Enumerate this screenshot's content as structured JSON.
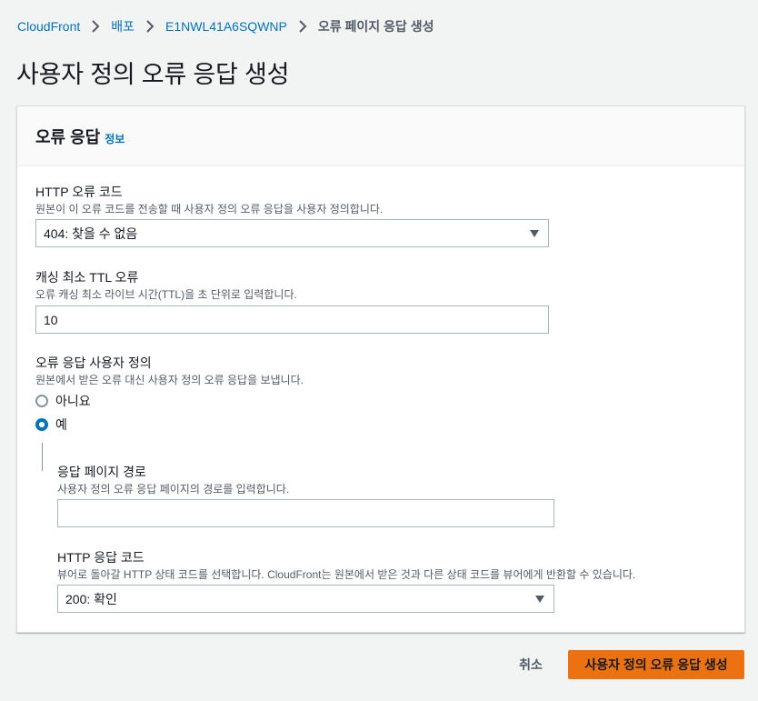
{
  "breadcrumb": {
    "items": [
      "CloudFront",
      "배포",
      "E1NWL41A6SQWNP"
    ],
    "current": "오류 페이지 응답 생성"
  },
  "page_title": "사용자 정의 오류 응답 생성",
  "panel": {
    "title": "오류 응답",
    "info_link": "정보"
  },
  "http_error_code": {
    "label": "HTTP 오류 코드",
    "description": "원본이 이 오류 코드를 전송할 때 사용자 정의 오류 응답을 사용자 정의합니다.",
    "selected": "404: 찾을 수 없음"
  },
  "min_ttl": {
    "label": "캐싱 최소 TTL 오류",
    "description": "오류 캐싱 최소 라이브 시간(TTL)을 초 단위로 입력합니다.",
    "value": "10"
  },
  "customize_response": {
    "label": "오류 응답 사용자 정의",
    "description": "원본에서 받은 오류 대신 사용자 정의 오류 응답을 보냅니다.",
    "options": [
      "아니요",
      "예"
    ],
    "selected": "예"
  },
  "response_page_path": {
    "label": "응답 페이지 경로",
    "description": "사용자 정의 오류 응답 페이지의 경로를 입력합니다.",
    "value": "",
    "placeholder": ""
  },
  "http_response_code": {
    "label": "HTTP 응답 코드",
    "description": "뷰어로 돌아갈 HTTP 상태 코드를 선택합니다. CloudFront는 원본에서 받은 것과 다른 상태 코드를 뷰어에게 반환할 수 있습니다.",
    "selected": "200: 확인"
  },
  "actions": {
    "cancel": "취소",
    "submit": "사용자 정의 오류 응답 생성"
  },
  "colors": {
    "link": "#0073bb",
    "primary_button": "#ec7211",
    "background": "#f2f3f3"
  }
}
